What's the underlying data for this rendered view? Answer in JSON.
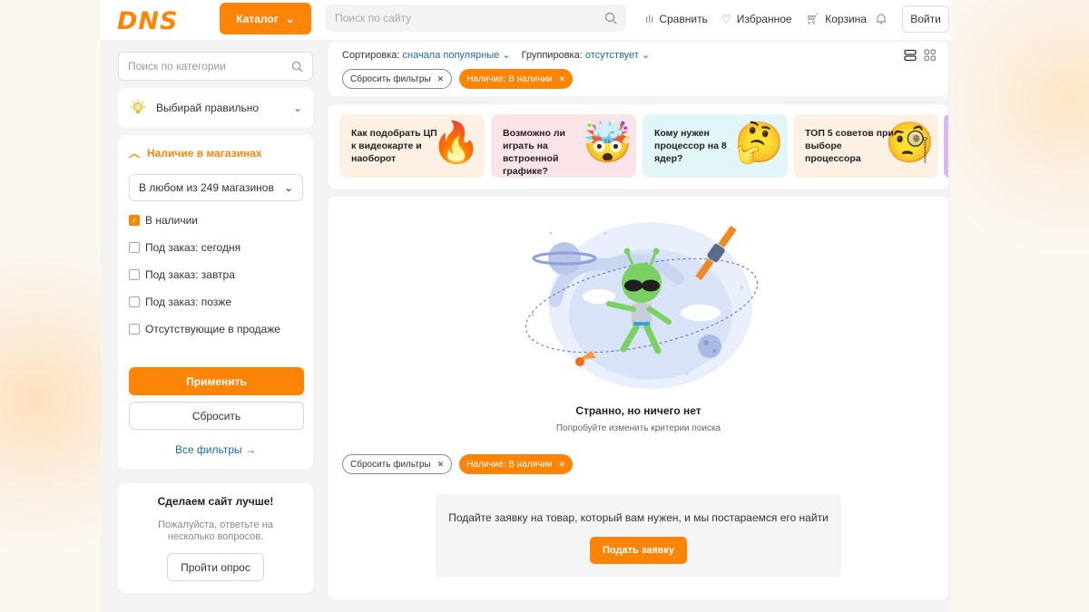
{
  "header": {
    "logo": "DNS",
    "catalog_label": "Каталог",
    "search_placeholder": "Поиск по сайту",
    "compare_label": "Сравнить",
    "favorites_label": "Избранное",
    "cart_label": "Корзина",
    "login_label": "Войти"
  },
  "sidebar": {
    "category_search_placeholder": "Поиск по категории",
    "tip_label": "Выбирай правильно",
    "availability": {
      "title": "Наличие в магазинах",
      "shop_select": "В любом из 249 магазинов",
      "options": [
        {
          "label": "В наличии",
          "checked": true
        },
        {
          "label": "Под заказ: сегодня",
          "checked": false
        },
        {
          "label": "Под заказ: завтра",
          "checked": false
        },
        {
          "label": "Под заказ: позже",
          "checked": false
        },
        {
          "label": "Отсутствующие в продаже",
          "checked": false
        }
      ]
    },
    "apply_label": "Применить",
    "reset_label": "Сбросить",
    "all_filters_label": "Все фильтры →",
    "survey": {
      "title": "Сделаем сайт лучше!",
      "text": "Пожалуйста, ответьте на несколько вопросов.",
      "button": "Пройти опрос"
    }
  },
  "toolbar": {
    "sort_label": "Сортировка:",
    "sort_value": "сначала популярные",
    "group_label": "Группировка:",
    "group_value": "отсутствует",
    "chip_reset": "Сбросить фильтры",
    "chip_active": "Наличие: В наличии"
  },
  "promos": [
    {
      "text": "Как подобрать ЦП к видеокарте и наоборот",
      "icon": "fire-emoji",
      "bg": "#fdf1e4"
    },
    {
      "text": "Возможно ли играть на встроенной графике?",
      "icon": "exploding-head-emoji",
      "bg": "#fbe4e8"
    },
    {
      "text": "Кому нужен процессор на 8 ядер?",
      "icon": "thinking-face-emoji",
      "bg": "#e2f6f8"
    },
    {
      "text": "ТОП 5 советов при выборе процессора",
      "icon": "monocle-face-emoji",
      "bg": "#fdf1e4"
    }
  ],
  "empty": {
    "title": "Странно, но ничего нет",
    "subtitle": "Попробуйте изменить критерии поиска",
    "request_text": "Подайте заявку на товар, который вам нужен, и мы постараемся его найти",
    "request_button": "Подать заявку"
  },
  "colors": {
    "accent": "#fc8507",
    "link": "#1e68b4"
  }
}
